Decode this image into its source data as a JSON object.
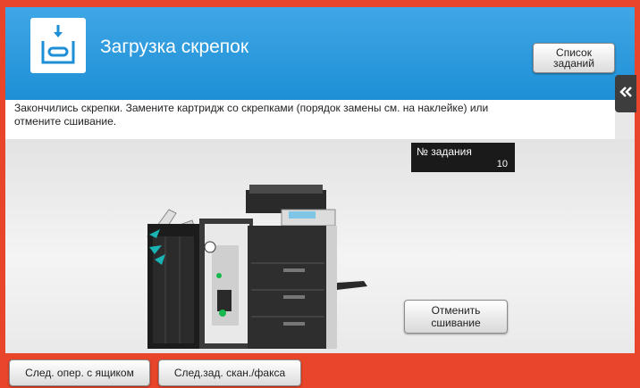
{
  "header": {
    "title": "Загрузка скрепок",
    "icon": "staple-load-icon",
    "color": "#2a98dc",
    "job_list_button": "Список заданий"
  },
  "side_tab": {
    "icon": "double-chevron-left-icon"
  },
  "message": "Закончились скрепки. Замените картридж со скрепками (порядок замены см. на наклейке) или отмените сшивание.",
  "job_badge": {
    "label": "№ задания",
    "value": "10"
  },
  "actions": {
    "cancel_stapling": "Отменить сшивание"
  },
  "footer": {
    "color": "#e8452a",
    "next_op_box": "След. опер. с ящиком",
    "next_scan_fax": "След.зад. скан./факса"
  }
}
